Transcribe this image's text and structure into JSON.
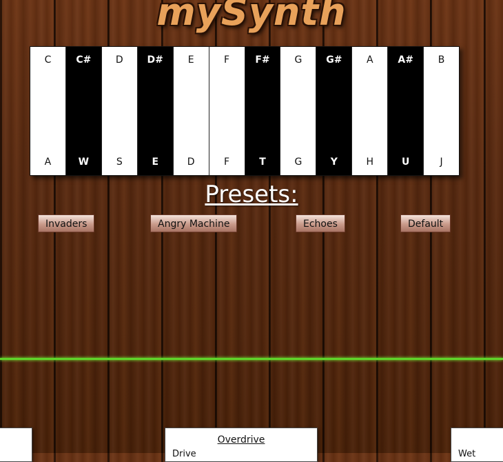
{
  "app": {
    "logo_text": "mySynth"
  },
  "keyboard": {
    "keys": [
      {
        "note": "C",
        "binding": "A",
        "color": "white"
      },
      {
        "note": "C#",
        "binding": "W",
        "color": "black"
      },
      {
        "note": "D",
        "binding": "S",
        "color": "white"
      },
      {
        "note": "D#",
        "binding": "E",
        "color": "black"
      },
      {
        "note": "E",
        "binding": "D",
        "color": "white"
      },
      {
        "note": "F",
        "binding": "F",
        "color": "white"
      },
      {
        "note": "F#",
        "binding": "T",
        "color": "black"
      },
      {
        "note": "G",
        "binding": "G",
        "color": "white"
      },
      {
        "note": "G#",
        "binding": "Y",
        "color": "black"
      },
      {
        "note": "A",
        "binding": "H",
        "color": "white"
      },
      {
        "note": "A#",
        "binding": "U",
        "color": "black"
      },
      {
        "note": "B",
        "binding": "J",
        "color": "white"
      }
    ]
  },
  "presets": {
    "title": "Presets:",
    "buttons": [
      {
        "label": "Invaders"
      },
      {
        "label": "Angry Machine"
      },
      {
        "label": "Echoes"
      },
      {
        "label": "Default"
      }
    ]
  },
  "panels": {
    "overdrive": {
      "title": "Overdrive",
      "label": "Drive"
    },
    "right": {
      "label": "Wet"
    }
  },
  "colors": {
    "accent_line": "#5fd42a",
    "logo": "#e8a15a",
    "wood": "#5a2a10"
  }
}
